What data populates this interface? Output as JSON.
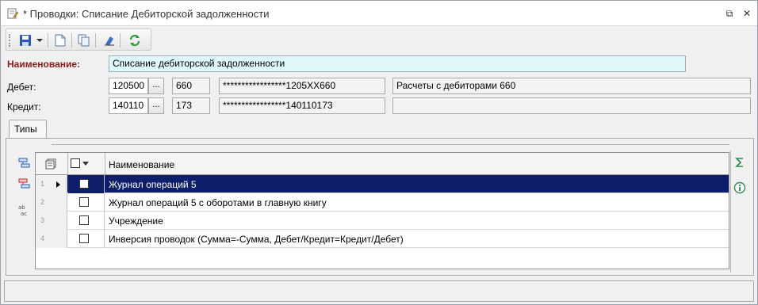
{
  "window": {
    "title": "* Проводки: Списание Дебиторской задолженности",
    "restore_glyph": "⧉",
    "close_glyph": "✕"
  },
  "toolbar": {
    "icons": [
      "save-icon",
      "dropdown-arrow-icon",
      "new-document-icon",
      "copy-icon",
      "clear-icon",
      "refresh-icon"
    ]
  },
  "form": {
    "name_label": "Наименование:",
    "name_value": "Списание дебиторской задолженности",
    "debit_label": "Дебет:",
    "debit": {
      "account": "120500",
      "code": "660",
      "masked": "*****************1205XX660",
      "description": "Расчеты с дебиторами 660"
    },
    "credit_label": "Кредит:",
    "credit": {
      "account": "140110",
      "code": "173",
      "masked": "*****************140110173",
      "description": ""
    },
    "dots_label": "..."
  },
  "tabs": [
    {
      "label": "Типы"
    }
  ],
  "grid": {
    "column_header": "Наименование",
    "rows": [
      {
        "num": "1",
        "name": "Журнал операций 5",
        "selected": true
      },
      {
        "num": "2",
        "name": "Журнал операций 5 с оборотами в главную книгу"
      },
      {
        "num": "3",
        "name": "Учреждение"
      },
      {
        "num": "4",
        "name": "Инверсия проводок (Сумма=-Сумма, Дебет/Кредит=Кредит/Дебет)"
      }
    ]
  },
  "colors": {
    "accent_red": "#8b1a1a",
    "selection": "#0d1f6a",
    "name_field_bg": "#dff9fb"
  }
}
